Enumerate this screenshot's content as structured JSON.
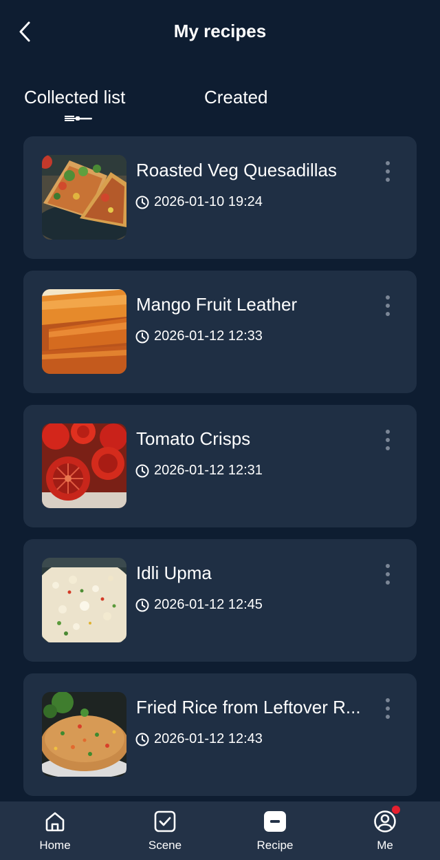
{
  "header": {
    "title": "My recipes",
    "back_icon": "chevron-left-icon"
  },
  "tabs": [
    {
      "label": "Collected list",
      "active": true
    },
    {
      "label": "Created",
      "active": false
    }
  ],
  "recipes": [
    {
      "title": "Roasted Veg Quesadillas",
      "time": "2026-01-10 19:24",
      "image": "quesadillas"
    },
    {
      "title": "Mango Fruit Leather",
      "time": "2026-01-12 12:33",
      "image": "fruit-leather"
    },
    {
      "title": "Tomato Crisps",
      "time": "2026-01-12 12:31",
      "image": "tomato-crisps"
    },
    {
      "title": "Idli Upma",
      "time": "2026-01-12 12:45",
      "image": "idli-upma"
    },
    {
      "title": "Fried Rice from Leftover R...",
      "time": "2026-01-12 12:43",
      "image": "fried-rice"
    }
  ],
  "nav": [
    {
      "label": "Home",
      "icon": "home-icon"
    },
    {
      "label": "Scene",
      "icon": "scene-checkbox-icon"
    },
    {
      "label": "Recipe",
      "icon": "recipe-icon",
      "active": true
    },
    {
      "label": "Me",
      "icon": "profile-icon",
      "badge": true
    }
  ],
  "colors": {
    "background": "#0e1d31",
    "card": "#1f2f44",
    "nav_bar": "#233247",
    "badge": "#e5202f"
  }
}
